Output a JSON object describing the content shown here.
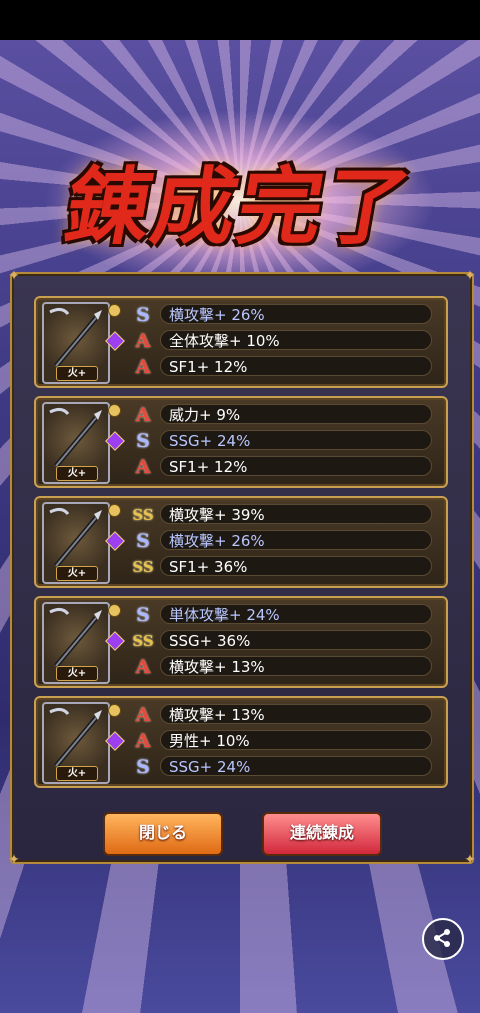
{
  "title": "錬成完了",
  "cards": [
    {
      "badge": "火+",
      "rows": [
        {
          "rank": "S",
          "text": "横攻撃+ 26%",
          "color": "blue"
        },
        {
          "rank": "A",
          "text": "全体攻撃+ 10%",
          "color": "white"
        },
        {
          "rank": "A",
          "text": "SF1+ 12%",
          "color": "white"
        }
      ]
    },
    {
      "badge": "火+",
      "rows": [
        {
          "rank": "A",
          "text": "威力+ 9%",
          "color": "white"
        },
        {
          "rank": "S",
          "text": "SSG+ 24%",
          "color": "blue"
        },
        {
          "rank": "A",
          "text": "SF1+ 12%",
          "color": "white"
        }
      ]
    },
    {
      "badge": "火+",
      "rows": [
        {
          "rank": "SS",
          "text": "横攻撃+ 39%",
          "color": "white"
        },
        {
          "rank": "S",
          "text": "横攻撃+ 26%",
          "color": "blue"
        },
        {
          "rank": "SS",
          "text": "SF1+ 36%",
          "color": "white"
        }
      ]
    },
    {
      "badge": "火+",
      "rows": [
        {
          "rank": "S",
          "text": "単体攻撃+ 24%",
          "color": "blue"
        },
        {
          "rank": "SS",
          "text": "SSG+ 36%",
          "color": "white"
        },
        {
          "rank": "A",
          "text": "横攻撃+ 13%",
          "color": "white"
        }
      ]
    },
    {
      "badge": "火+",
      "rows": [
        {
          "rank": "A",
          "text": "横攻撃+ 13%",
          "color": "white"
        },
        {
          "rank": "A",
          "text": "男性+ 10%",
          "color": "white"
        },
        {
          "rank": "S",
          "text": "SSG+ 24%",
          "color": "blue"
        }
      ]
    }
  ],
  "buttons": {
    "close": "閉じる",
    "continuous": "連続錬成"
  },
  "share_icon": "share-icon"
}
